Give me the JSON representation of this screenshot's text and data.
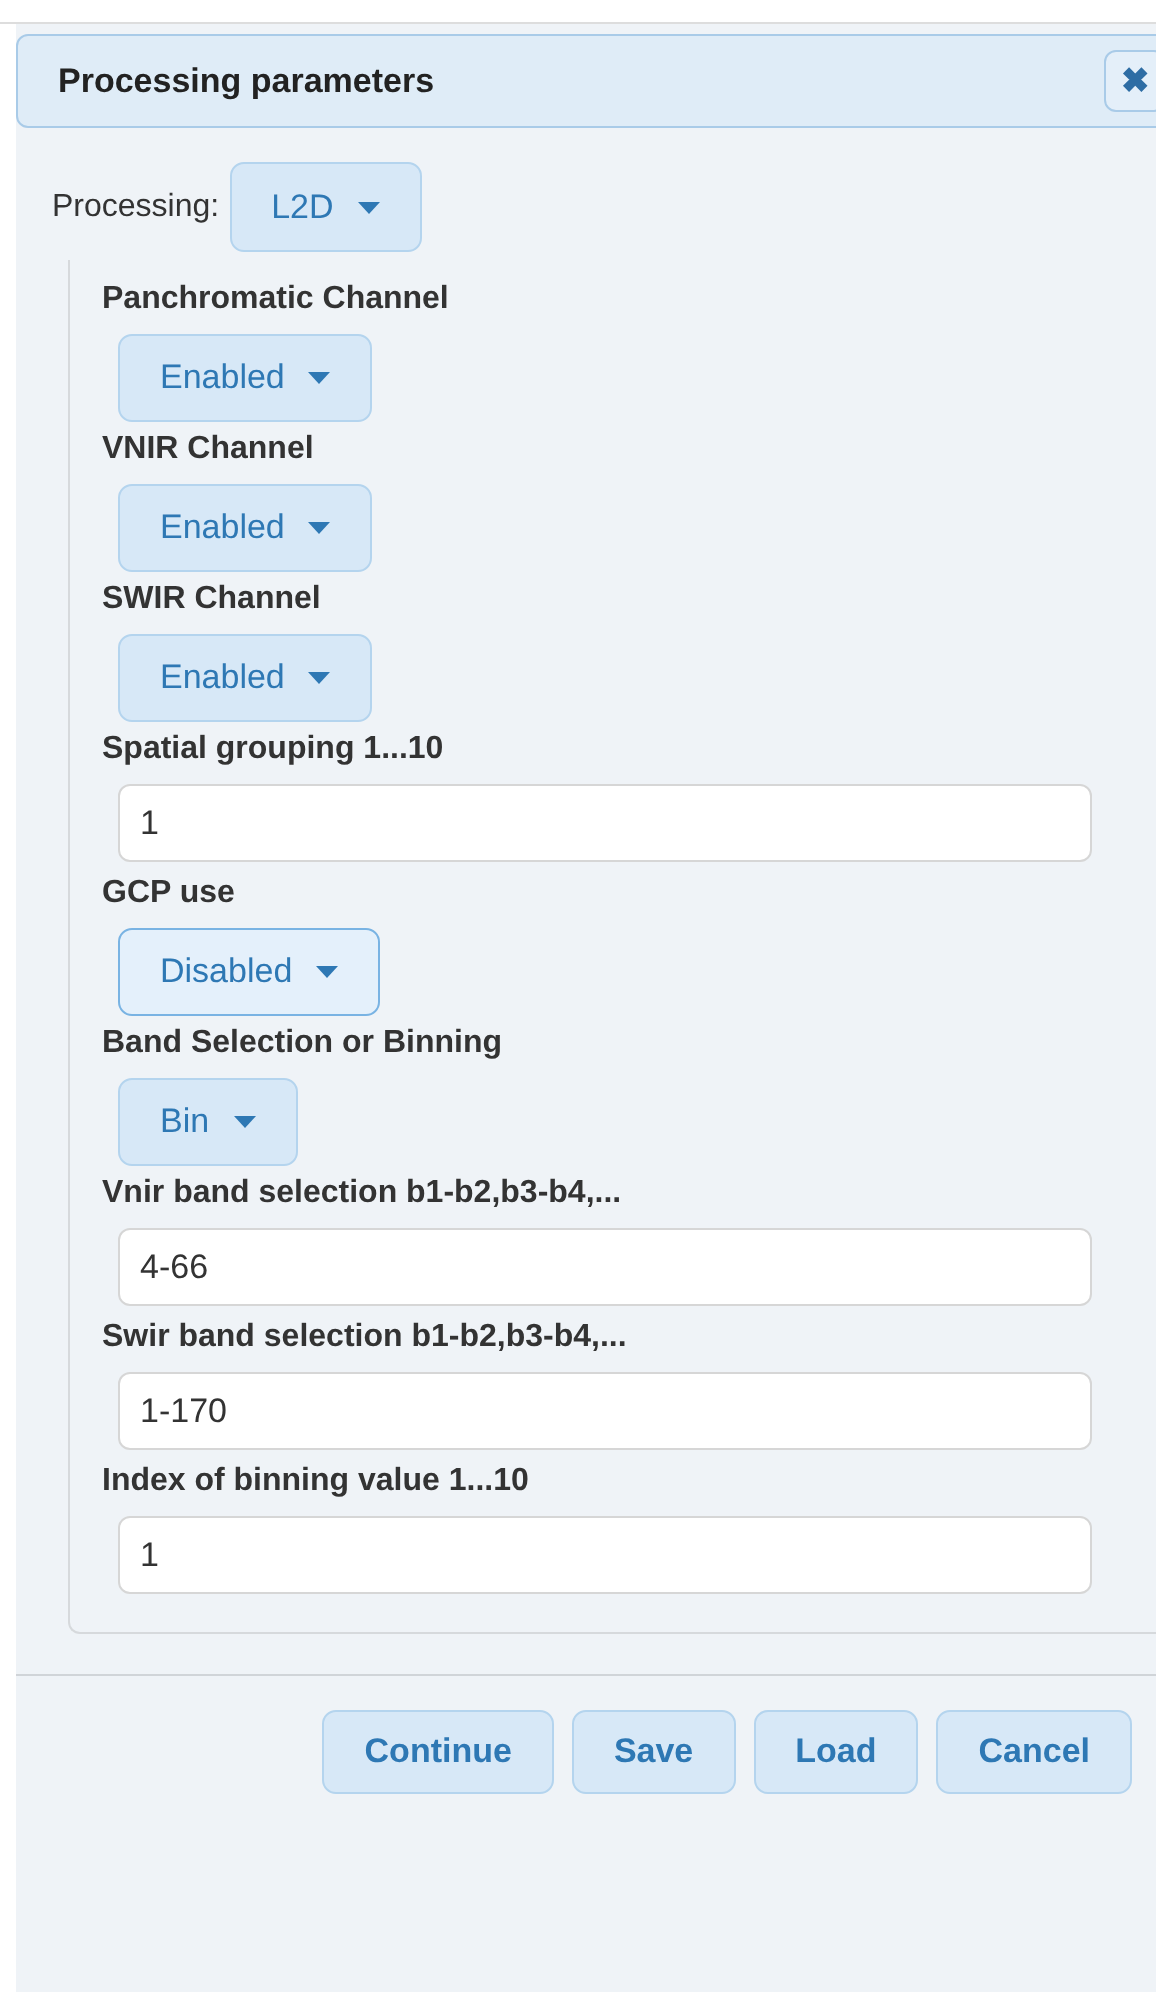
{
  "dialog": {
    "title": "Processing parameters",
    "close": "✖"
  },
  "processing": {
    "label": "Processing:",
    "value": "L2D"
  },
  "fields": [
    {
      "kind": "dropdown",
      "label": "Panchromatic Channel",
      "value": "Enabled",
      "focused": false
    },
    {
      "kind": "dropdown",
      "label": "VNIR Channel",
      "value": "Enabled",
      "focused": false
    },
    {
      "kind": "dropdown",
      "label": "SWIR Channel",
      "value": "Enabled",
      "focused": false
    },
    {
      "kind": "text",
      "label": "Spatial grouping 1...10",
      "value": "1"
    },
    {
      "kind": "dropdown",
      "label": "GCP use",
      "value": "Disabled",
      "focused": true
    },
    {
      "kind": "dropdown",
      "label": "Band Selection or Binning",
      "value": "Bin",
      "focused": false
    },
    {
      "kind": "text",
      "label": "Vnir band selection b1-b2,b3-b4,...",
      "value": "4-66"
    },
    {
      "kind": "text",
      "label": "Swir band selection b1-b2,b3-b4,...",
      "value": "1-170"
    },
    {
      "kind": "text",
      "label": "Index of binning value 1...10",
      "value": "1"
    }
  ],
  "buttons": [
    "Continue",
    "Save",
    "Load",
    "Cancel"
  ]
}
